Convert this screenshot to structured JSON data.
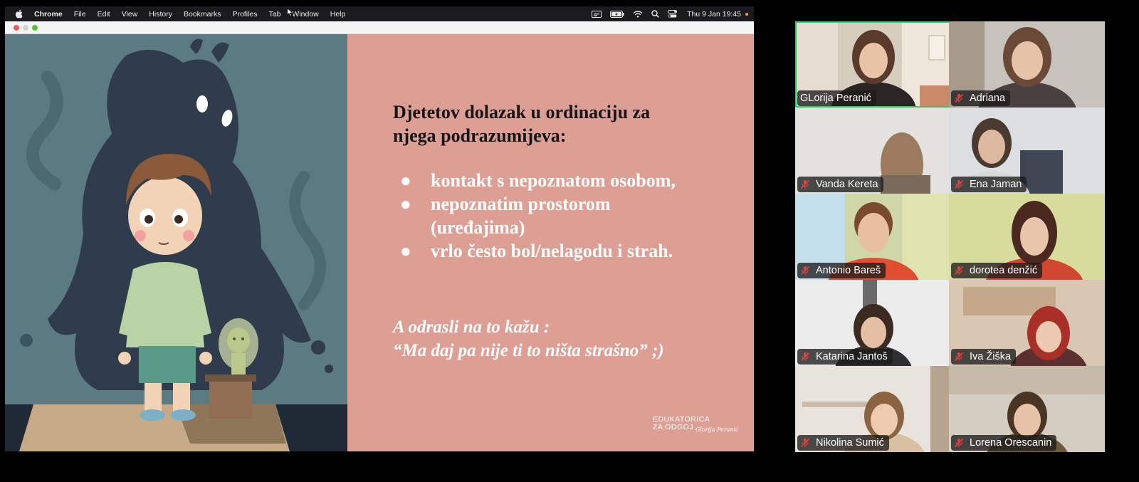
{
  "menubar": {
    "apple_icon": "apple-icon",
    "app_name": "Chrome",
    "items": [
      "File",
      "Edit",
      "View",
      "History",
      "Bookmarks",
      "Profiles",
      "Tab",
      "Window",
      "Help"
    ],
    "clock": "Thu 9 Jan  19:45",
    "status_icons": [
      "caption-icon",
      "battery-icon",
      "wifi-icon",
      "search-icon",
      "control-center-icon"
    ],
    "recording_dot_color": "#f0a030"
  },
  "slide": {
    "background_color": "#dd9f94",
    "heading_line1": "Djetetov dolazak u ordinaciju za",
    "heading_line2": "njega podrazumijeva:",
    "bullet_symbol": "●",
    "bullets": [
      {
        "line1": "kontakt s nepoznatom osobom,",
        "line2": ""
      },
      {
        "line1": "nepoznatim prostorom",
        "line2": "(uređajima)"
      },
      {
        "line1": "vrlo često bol/nelagodu i strah.",
        "line2": ""
      }
    ],
    "quote_line1": "A odrasli na to kažu :",
    "quote_line2": "“Ma daj pa nije ti to ništa strašno” ;)",
    "watermark_line1": "EDUKATORICA",
    "watermark_line2": "ZA ODGOJ",
    "watermark_signature": "Glorija Peranić"
  },
  "gallery": {
    "active_speaker_color": "#23d160",
    "mute_icon": "microphone-muted-icon",
    "participants": [
      {
        "name": "GLorija Peranić",
        "muted": false,
        "active": true
      },
      {
        "name": "Adriana",
        "muted": true,
        "active": false
      },
      {
        "name": "Vanda Kereta",
        "muted": true,
        "active": false
      },
      {
        "name": "Ena Jaman",
        "muted": true,
        "active": false
      },
      {
        "name": "Antonio Bareš",
        "muted": true,
        "active": false
      },
      {
        "name": "dorotea denžić",
        "muted": true,
        "active": false
      },
      {
        "name": "Katarina Jantoš",
        "muted": true,
        "active": false
      },
      {
        "name": "Iva Žiška",
        "muted": true,
        "active": false
      },
      {
        "name": "Nikolina Sumić",
        "muted": true,
        "active": false
      },
      {
        "name": "Lorena Orescanin",
        "muted": true,
        "active": false
      }
    ]
  }
}
